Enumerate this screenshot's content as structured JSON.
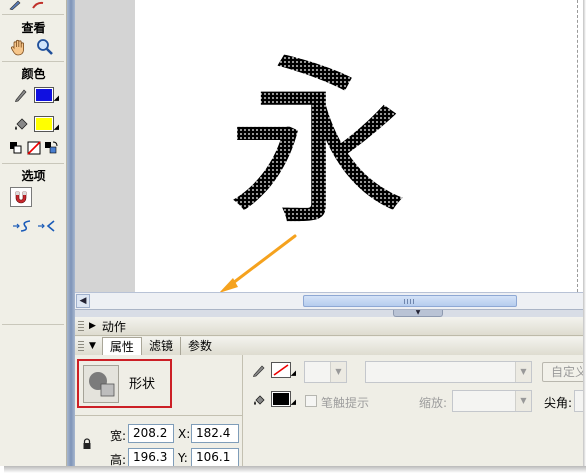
{
  "tools_panel": {
    "view_header": "查看",
    "colors_header": "颜色",
    "options_header": "选项",
    "stroke_color": "#1010e0",
    "fill_color": "#ffff00"
  },
  "stage": {
    "character": "永",
    "arrow_color": "#f5a21e"
  },
  "actions_panel": {
    "title": "动作"
  },
  "properties_panel": {
    "tabs": [
      "属性",
      "滤镜",
      "参数"
    ],
    "shape_label": "形状",
    "width_label": "宽:",
    "width_value": "208.2",
    "height_label": "高:",
    "height_value": "196.3",
    "x_label": "X:",
    "x_value": "182.4",
    "y_label": "Y:",
    "y_value": "106.1",
    "stroke_hint_label": "笔触提示",
    "scale_label": "缩放:",
    "custom_button": "自定义",
    "cap_label": "尖角:"
  }
}
